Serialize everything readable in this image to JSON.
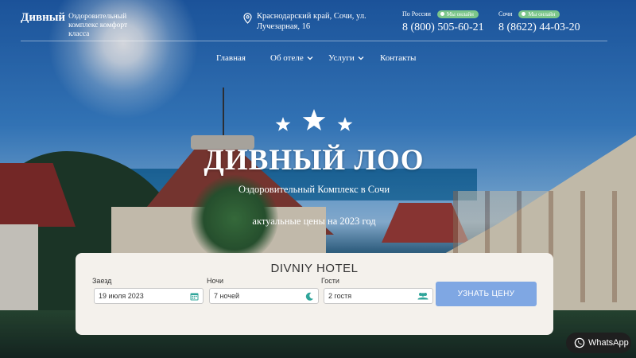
{
  "header": {
    "logo_name": "Дивный",
    "logo_subtitle": "Оздоровительный комплекс комфорт класса",
    "address_line1": "Краснодарский край, Сочи, ул.",
    "address_line2": "Лучезарная, 16",
    "phones": [
      {
        "region": "По России",
        "badge": "Мы онлайн",
        "number": "8 (800) 505-60-21"
      },
      {
        "region": "Сочи",
        "badge": "Мы онлайн",
        "number": "8 (8622) 44-03-20"
      }
    ]
  },
  "nav": {
    "items": [
      {
        "label": "Главная",
        "has_dropdown": false
      },
      {
        "label": "Об отеле",
        "has_dropdown": true
      },
      {
        "label": "Услуги",
        "has_dropdown": true
      },
      {
        "label": "Контакты",
        "has_dropdown": false
      }
    ]
  },
  "hero": {
    "star_count": 3,
    "title": "ДИВНЫЙ ЛОО",
    "subtitle": "Оздоровительный Комплекс в Сочи",
    "prices_text": "актуальные цены на 2023 год"
  },
  "booking": {
    "title": "DIVNIY HOTEL",
    "checkin_label": "Заезд",
    "checkin_value": "19 июля 2023",
    "nights_label": "Ночи",
    "nights_value": "7 ночей",
    "guests_label": "Гости",
    "guests_value": "2 гостя",
    "submit_label": "УЗНАТЬ ЦЕНУ"
  },
  "whatsapp": {
    "label": "WhatsApp"
  },
  "colors": {
    "badge_green": "#7cc68a",
    "button_blue": "#7fa7e3",
    "icon_teal": "#2fa59a",
    "panel_bg": "#f4f1ec"
  }
}
